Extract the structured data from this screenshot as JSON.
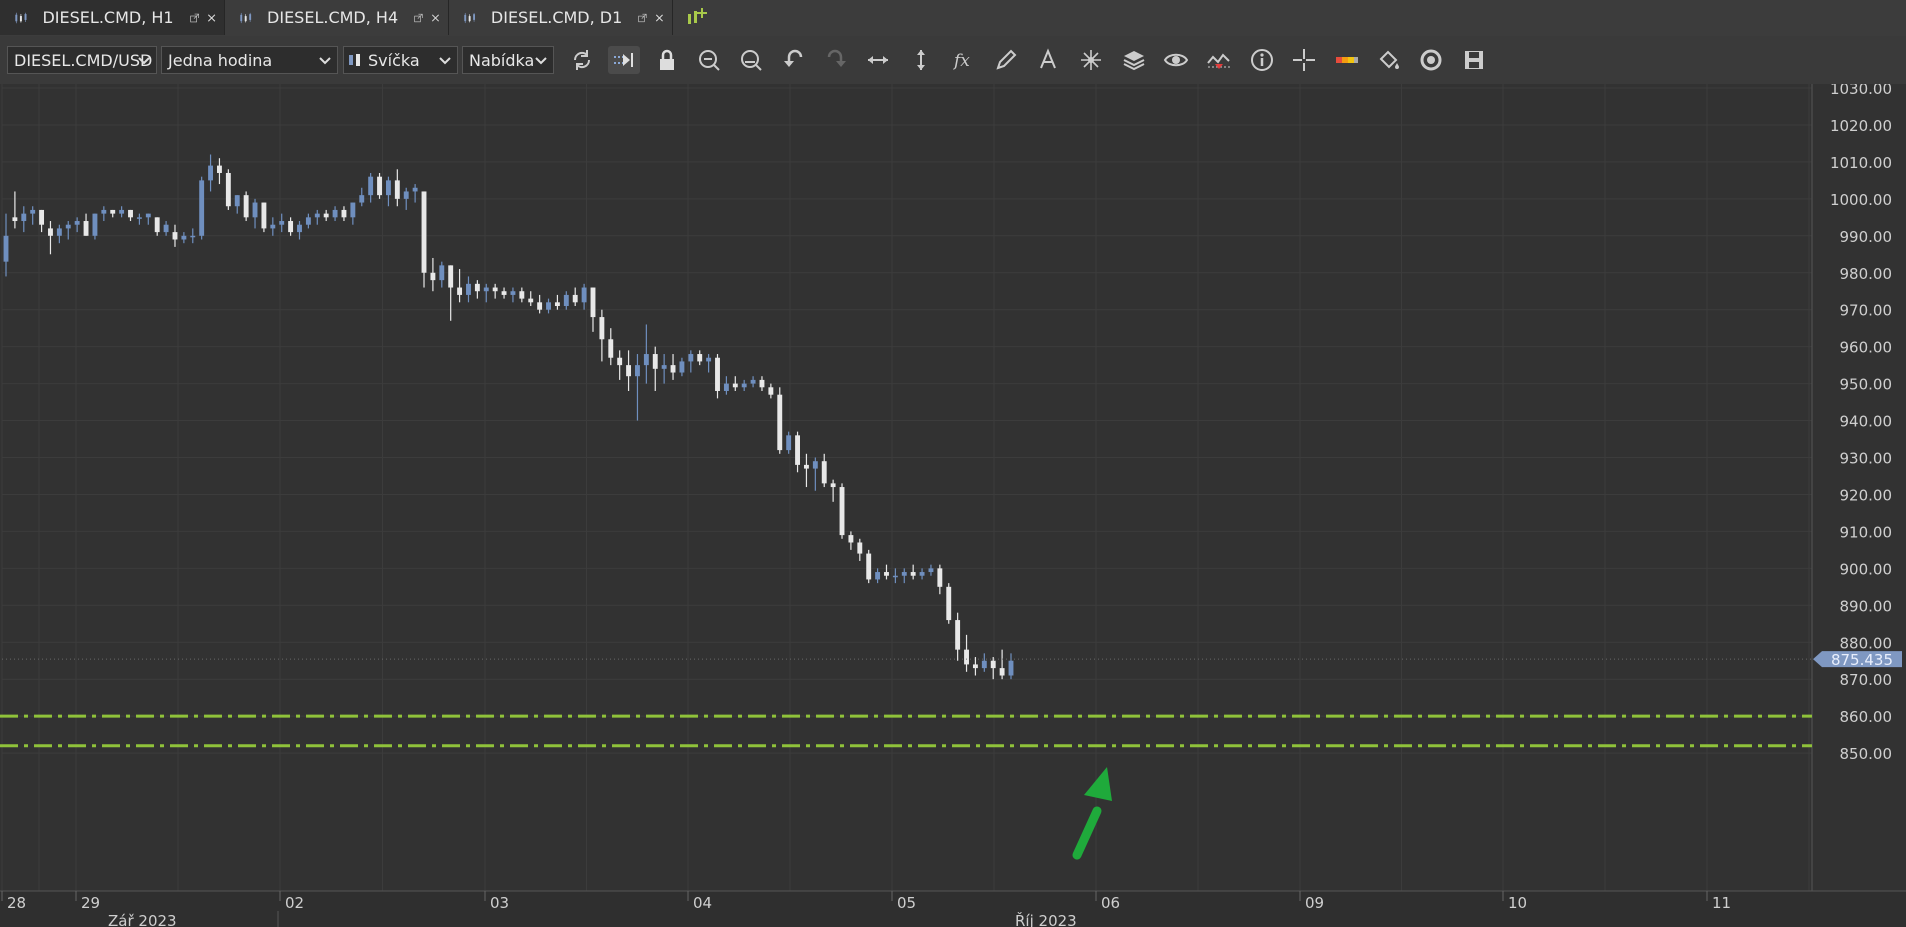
{
  "tabs": [
    {
      "label": "DIESEL.CMD, H1",
      "active": true
    },
    {
      "label": "DIESEL.CMD, H4",
      "active": false
    },
    {
      "label": "DIESEL.CMD, D1",
      "active": false
    }
  ],
  "toolbar": {
    "instrument": "DIESEL.CMD/USD",
    "period": "Jedna hodina",
    "chart_type": "Svíčka",
    "price_side": "Nabídka",
    "tools": [
      "refresh-icon",
      "autoshift-icon",
      "lock-icon",
      "zoom-in-icon",
      "zoom-out-icon",
      "undo-icon",
      "redo-icon",
      "horizontal-scale-icon",
      "vertical-scale-icon",
      "function-icon",
      "pencil-icon",
      "text-icon",
      "star-icon",
      "layers-icon",
      "eye-icon",
      "indicator-icon",
      "info-icon",
      "crosshair-icon",
      "color-bar-icon",
      "paint-bucket-icon",
      "circle-icon",
      "save-icon"
    ]
  },
  "colors": {
    "background": "#323232",
    "grid": "#3c3c3c",
    "bull": "#6f8fbf",
    "bear": "#e8e8e8",
    "level": "#8fc23a",
    "arrow": "#1faa3b",
    "price_tag": "#7f98c2"
  },
  "chart_data": {
    "type": "candlestick",
    "symbol": "DIESEL.CMD/USD",
    "timeframe": "H1",
    "y_ticks": [
      "1030.00",
      "1020.00",
      "1010.00",
      "1000.00",
      "990.00",
      "980.00",
      "970.00",
      "960.00",
      "950.00",
      "940.00",
      "930.00",
      "920.00",
      "910.00",
      "900.00",
      "890.00",
      "880.00",
      "870.00",
      "860.00",
      "850.00"
    ],
    "y_range": [
      850,
      1030
    ],
    "x_ticks": [
      "28",
      "29",
      "02",
      "03",
      "04",
      "05",
      "06",
      "09",
      "10",
      "11"
    ],
    "x_periods": [
      "Zář 2023",
      "Říj 2023"
    ],
    "current_price": "875.435",
    "current_value": 875.435,
    "levels": [
      860,
      852
    ],
    "grid": true,
    "candles_ohlc": [
      [
        983,
        996,
        979,
        990
      ],
      [
        995,
        1002,
        992,
        994
      ],
      [
        994,
        998,
        991,
        996
      ],
      [
        996,
        998,
        993,
        997
      ],
      [
        997,
        997,
        991,
        993
      ],
      [
        992,
        994,
        985,
        990
      ],
      [
        990,
        993,
        988,
        992
      ],
      [
        992,
        994,
        989,
        993
      ],
      [
        993,
        995,
        991,
        994
      ],
      [
        994,
        996,
        990,
        990
      ],
      [
        990,
        996,
        989,
        996
      ],
      [
        996,
        998,
        994,
        997
      ],
      [
        997,
        997,
        995,
        996
      ],
      [
        996,
        998,
        995,
        997
      ],
      [
        997,
        997,
        994,
        995
      ],
      [
        995,
        996,
        993,
        995
      ],
      [
        995,
        996,
        993,
        996
      ],
      [
        995,
        995,
        990,
        991
      ],
      [
        991,
        994,
        990,
        993
      ],
      [
        991,
        993,
        987,
        989
      ],
      [
        989,
        991,
        988,
        990
      ],
      [
        990,
        992,
        988,
        990
      ],
      [
        990,
        1006,
        989,
        1005
      ],
      [
        1005,
        1012,
        1002,
        1009
      ],
      [
        1009,
        1011,
        1004,
        1007
      ],
      [
        1007,
        1008,
        997,
        998
      ],
      [
        998,
        1001,
        996,
        1001
      ],
      [
        1001,
        1002,
        994,
        995
      ],
      [
        995,
        1000,
        992,
        999
      ],
      [
        999,
        999,
        991,
        992
      ],
      [
        992,
        995,
        990,
        993
      ],
      [
        993,
        996,
        991,
        994
      ],
      [
        994,
        995,
        990,
        991
      ],
      [
        991,
        994,
        989,
        993
      ],
      [
        993,
        996,
        992,
        995
      ],
      [
        995,
        997,
        993,
        996
      ],
      [
        996,
        997,
        994,
        995
      ],
      [
        995,
        998,
        994,
        997
      ],
      [
        997,
        998,
        994,
        995
      ],
      [
        995,
        999,
        993,
        999
      ],
      [
        999,
        1003,
        998,
        1001
      ],
      [
        1001,
        1007,
        999,
        1006
      ],
      [
        1006,
        1007,
        1000,
        1001
      ],
      [
        1001,
        1006,
        998,
        1005
      ],
      [
        1005,
        1008,
        998,
        1000
      ],
      [
        1000,
        1003,
        997,
        1002
      ],
      [
        1002,
        1004,
        999,
        1003
      ],
      [
        1002,
        1002,
        976,
        980
      ],
      [
        980,
        984,
        975,
        978
      ],
      [
        978,
        983,
        976,
        982
      ],
      [
        982,
        982,
        967,
        976
      ],
      [
        976,
        981,
        972,
        974
      ],
      [
        974,
        979,
        972,
        977
      ],
      [
        977,
        978,
        973,
        975
      ],
      [
        975,
        977,
        972,
        976
      ],
      [
        976,
        977,
        973,
        975
      ],
      [
        975,
        976,
        973,
        974
      ],
      [
        974,
        976,
        972,
        975
      ],
      [
        975,
        976,
        972,
        973
      ],
      [
        973,
        975,
        971,
        972
      ],
      [
        972,
        974,
        969,
        970
      ],
      [
        970,
        973,
        969,
        972
      ],
      [
        972,
        974,
        970,
        971
      ],
      [
        971,
        975,
        970,
        974
      ],
      [
        974,
        976,
        971,
        972
      ],
      [
        972,
        977,
        970,
        976
      ],
      [
        976,
        976,
        964,
        968
      ],
      [
        968,
        970,
        956,
        962
      ],
      [
        962,
        965,
        955,
        957
      ],
      [
        957,
        959,
        951,
        955
      ],
      [
        955,
        959,
        948,
        952
      ],
      [
        952,
        958,
        940,
        955
      ],
      [
        955,
        966,
        950,
        958
      ],
      [
        958,
        960,
        948,
        954
      ],
      [
        954,
        958,
        950,
        955
      ],
      [
        955,
        958,
        951,
        953
      ],
      [
        953,
        957,
        952,
        956
      ],
      [
        956,
        959,
        953,
        958
      ],
      [
        958,
        959,
        955,
        956
      ],
      [
        956,
        958,
        953,
        957
      ],
      [
        957,
        958,
        946,
        948
      ],
      [
        948,
        952,
        947,
        950
      ],
      [
        950,
        952,
        948,
        949
      ],
      [
        949,
        951,
        948,
        950
      ],
      [
        950,
        952,
        949,
        951
      ],
      [
        951,
        952,
        948,
        949
      ],
      [
        949,
        950,
        946,
        947
      ],
      [
        947,
        949,
        931,
        932
      ],
      [
        932,
        937,
        931,
        936
      ],
      [
        936,
        937,
        926,
        928
      ],
      [
        928,
        931,
        922,
        927
      ],
      [
        927,
        930,
        921,
        929
      ],
      [
        929,
        931,
        922,
        923
      ],
      [
        923,
        924,
        918,
        922
      ],
      [
        922,
        923,
        908,
        909
      ],
      [
        909,
        910,
        905,
        907
      ],
      [
        907,
        908,
        902,
        904
      ],
      [
        904,
        905,
        896,
        897
      ],
      [
        897,
        900,
        896,
        899
      ],
      [
        899,
        901,
        897,
        898
      ],
      [
        898,
        900,
        896,
        898
      ],
      [
        898,
        900,
        896,
        899
      ],
      [
        899,
        901,
        897,
        898
      ],
      [
        898,
        900,
        897,
        899
      ],
      [
        899,
        901,
        898,
        900
      ],
      [
        900,
        901,
        893,
        895
      ],
      [
        895,
        896,
        885,
        886
      ],
      [
        886,
        888,
        875,
        878
      ],
      [
        878,
        882,
        872,
        874
      ],
      [
        874,
        876,
        871,
        873
      ],
      [
        873,
        877,
        872,
        875
      ],
      [
        875,
        876,
        870,
        873
      ],
      [
        873,
        878,
        870,
        871
      ],
      [
        871,
        877,
        870,
        875
      ]
    ]
  }
}
